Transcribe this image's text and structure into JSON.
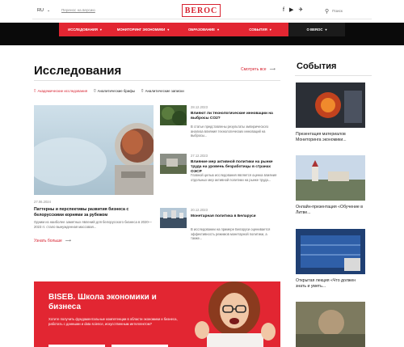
{
  "header": {
    "lang": "RU",
    "lang_link": "Перенос на версию",
    "logo": "BEROC",
    "socials": [
      "f",
      "▶",
      "✈"
    ],
    "search_placeholder": "Поиск"
  },
  "nav": [
    {
      "label": "Исследования",
      "style": "red"
    },
    {
      "label": "Мониторинг экономики",
      "style": "red"
    },
    {
      "label": "Образование",
      "style": "red"
    },
    {
      "label": "События",
      "style": "red"
    },
    {
      "label": "О BEROC",
      "style": "dark"
    }
  ],
  "research": {
    "title": "Исследования",
    "see_all": "Смотреть все",
    "tabs": [
      {
        "label": "Академические исследования",
        "active": true
      },
      {
        "label": "Аналитические брифы",
        "active": false
      },
      {
        "label": "Аналитические записки",
        "active": false
      }
    ],
    "featured": {
      "date": "27.06.2024",
      "title": "Паттерны и перспективы развития бизнеса с белорусскими корнями за рубежом",
      "desc": "Одним из наиболее заметных явлений для белорусского бизнеса в 2020—2023 гг. стало вынужденная массовая..."
    },
    "more": "Узнать больше",
    "news": [
      {
        "date": "28.12.2023",
        "title": "Влияют ли технологические инновации на выбросы CO2?",
        "desc": "В статье представлены результаты эмпирического анализа влияния технологических инноваций на выбросы..."
      },
      {
        "date": "27.12.2023",
        "title": "Влияние мер активной политики на рынке труда на уровень безработицы в странах ОЭСР",
        "desc": "Главной целью исследования является оценка влияния отдельных мер активной политики на рынке труда..."
      },
      {
        "date": "20.12.2023",
        "title": "Монетарная политика в Беларуси",
        "desc": "В исследовании на примере Беларуси оценивается эффективность режимов монетарной политики, а также..."
      }
    ]
  },
  "events": {
    "title": "События",
    "items": [
      {
        "caption": "Презентация материалов Мониторинга экономики..."
      },
      {
        "caption": "Онлайн-презентация «Обучение в Литве..."
      },
      {
        "caption": "Открытая лекция «Что должен знать и уметь..."
      },
      {
        "caption": ""
      }
    ]
  },
  "banner": {
    "title": "BISEB. Школа экономики и бизнеса",
    "text": "Хотите получить фундаментальные компетенции в области экономики и бизнеса, работать с данными и data science, искусственным интеллектом?"
  },
  "colors": {
    "accent": "#e22632",
    "dark": "#0a0a0a",
    "nav_dark": "#1b1b1b"
  }
}
